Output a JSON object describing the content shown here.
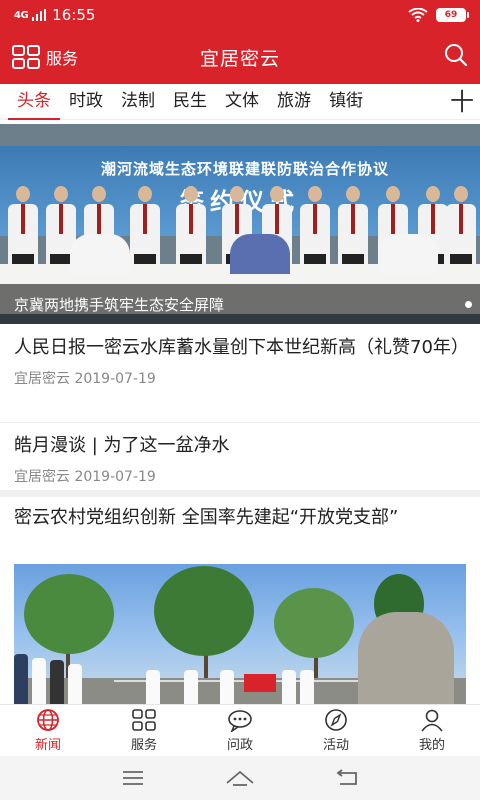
{
  "status_bar": {
    "signal": "4G",
    "time": "16:55",
    "battery": "69"
  },
  "header": {
    "services_label": "服务",
    "title": "宜居密云",
    "icons": {
      "menu": "grid-icon",
      "search": "search-icon"
    }
  },
  "tabs": [
    {
      "label": "头条",
      "active": true
    },
    {
      "label": "时政"
    },
    {
      "label": "法制"
    },
    {
      "label": "民生"
    },
    {
      "label": "文体"
    },
    {
      "label": "旅游"
    },
    {
      "label": "镇街"
    }
  ],
  "tab_add_label": "十",
  "banner": {
    "backdrop_line1": "潮河流域生态环境联建联防联治合作协议",
    "backdrop_line2": "签约仪式",
    "caption": "京冀两地携手筑牢生态安全屏障"
  },
  "news": [
    {
      "headline": "人民日报一密云水库蓄水量创下本世纪新高（礼赞70年）",
      "source": "宜居密云",
      "date": "2019-07-19"
    },
    {
      "headline": "皓月漫谈 | 为了这一盆净水",
      "source": "宜居密云",
      "date": "2019-07-19"
    },
    {
      "headline": "密云农村党组织创新 全国率先建起“开放党支部”"
    }
  ],
  "bottom_nav": [
    {
      "label": "新闻",
      "icon": "globe-icon",
      "active": true
    },
    {
      "label": "服务",
      "icon": "grid-icon"
    },
    {
      "label": "问政",
      "icon": "chat-bubble-icon"
    },
    {
      "label": "活动",
      "icon": "compass-icon"
    },
    {
      "label": "我的",
      "icon": "user-icon"
    }
  ],
  "system_nav": [
    "menu-icon",
    "home-icon",
    "back-icon"
  ],
  "colors": {
    "brand_red": "#d8232a",
    "text": "#222222",
    "meta": "#888888"
  }
}
